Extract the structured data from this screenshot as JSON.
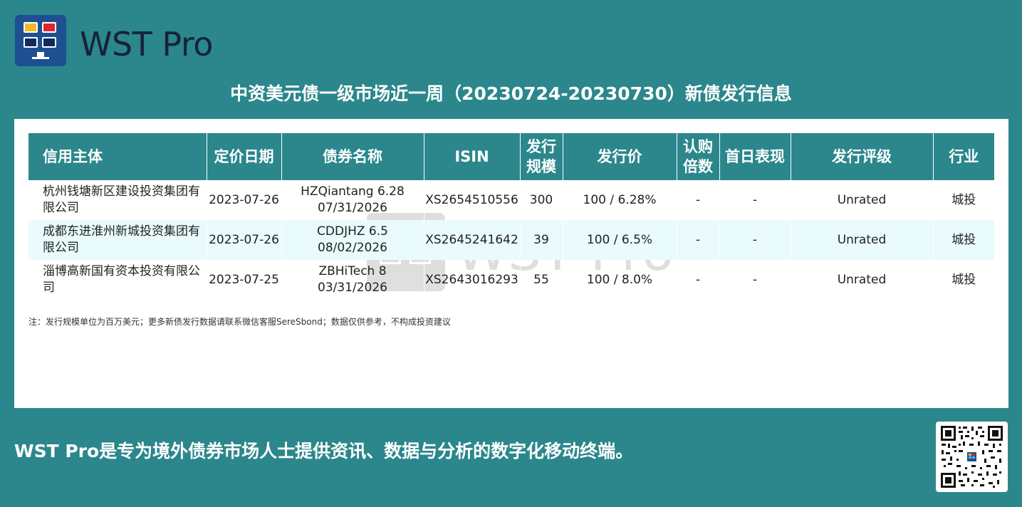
{
  "brand": {
    "name": "WST Pro",
    "logo_colors": {
      "background": "#1e4f91",
      "yellow": "#f4b92b",
      "red": "#e0262c",
      "navy": "#0e2d59"
    }
  },
  "title": "中资美元债一级市场近一周（20230724-20230730）新债发行信息",
  "table": {
    "headers": {
      "issuer": "信用主体",
      "pricing_date": "定价日期",
      "bond_name": "债券名称",
      "isin": "ISIN",
      "size_line1": "发行",
      "size_line2": "规模",
      "price": "发行价",
      "subscription_line1": "认购",
      "subscription_line2": "倍数",
      "first_day": "首日表现",
      "rating": "发行评级",
      "industry": "行业"
    },
    "rows": [
      {
        "issuer": "杭州钱塘新区建设投资集团有限公司",
        "pricing_date": "2023-07-26",
        "bond_name_line1": "HZQiantang 6.28",
        "bond_name_line2": "07/31/2026",
        "isin": "XS2654510556",
        "size": "300",
        "price": "100 / 6.28%",
        "subscription": "-",
        "first_day": "-",
        "rating": "Unrated",
        "industry": "城投"
      },
      {
        "issuer": "成都东进淮州新城投资集团有限公司",
        "pricing_date": "2023-07-26",
        "bond_name_line1": "CDDJHZ 6.5",
        "bond_name_line2": "08/02/2026",
        "isin": "XS2645241642",
        "size": "39",
        "price": "100 / 6.5%",
        "subscription": "-",
        "first_day": "-",
        "rating": "Unrated",
        "industry": "城投"
      },
      {
        "issuer": "淄博高新国有资本投资有限公司",
        "pricing_date": "2023-07-25",
        "bond_name_line1": "ZBHiTech 8",
        "bond_name_line2": "03/31/2026",
        "isin": "XS2643016293",
        "size": "55",
        "price": "100 / 8.0%",
        "subscription": "-",
        "first_day": "-",
        "rating": "Unrated",
        "industry": "城投"
      }
    ],
    "header_color": "#2b878c",
    "alt_row_color": "#e9fbfc"
  },
  "note": "注：发行规模单位为百万美元；更多新债发行数据请联系微信客服SereSbond；数据仅供参考，不构成投资建议",
  "watermark": "WST Pro",
  "tagline": "WST Pro是专为境外债券市场人士提供资讯、数据与分析的数字化移动终端。",
  "theme": {
    "background": "#2b878c",
    "panel": "#ffffff"
  }
}
